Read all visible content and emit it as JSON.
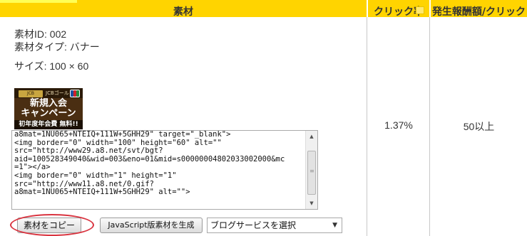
{
  "header": {
    "col_material": "素材",
    "col_click_rate": "クリック率",
    "col_reward": "発生報酬額/クリック"
  },
  "material": {
    "id": "素材ID: 002",
    "type": "素材タイプ: バナー",
    "size": "サイズ: 100 × 60"
  },
  "banner": {
    "card_text": "JCB",
    "brand_text": "JCBゴールド",
    "line1": "新規入会",
    "line2": "キャンペーン",
    "line3": "初年度年会費 無料!!"
  },
  "code": {
    "lines": "a8mat=1NU065+NTEIQ+111W+5GHH29\" target=\"_blank\">\n<img border=\"0\" width=\"100\" height=\"60\" alt=\"\"\nsrc=\"http://www29.a8.net/svt/bgt?\naid=100528349040&wid=003&eno=01&mid=s00000004802033002000&mc\n=1\"></a>\n<img border=\"0\" width=\"1\" height=\"1\"\nsrc=\"http://www11.a8.net/0.gif?\na8mat=1NU065+NTEIQ+111W+5GHH29\" alt=\"\">"
  },
  "buttons": {
    "copy": "素材をコピー",
    "js": "JavaScript版素材を生成"
  },
  "blog_select": {
    "selected": "ブログサービスを選択"
  },
  "stats": {
    "click_rate": "1.37%",
    "reward": "50以上"
  },
  "colors": {
    "header_bg": "#ffd400",
    "highlight_circle": "#d9333f"
  }
}
